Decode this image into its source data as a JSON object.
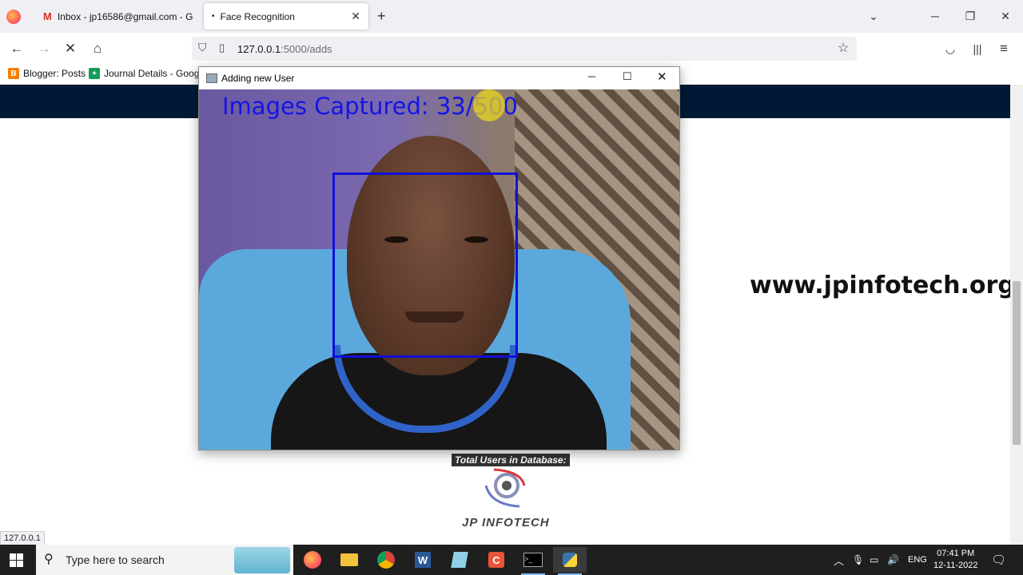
{
  "browser": {
    "tabs": [
      {
        "label": "Inbox - jp16586@gmail.com - G",
        "icon": "gmail-icon",
        "active": false
      },
      {
        "label": "Face Recognition",
        "icon": "loading-icon",
        "active": true
      }
    ],
    "url": {
      "host": "127.0.0.1",
      "path": ":5000/adds"
    },
    "bookmarks": [
      {
        "label": "Blogger: Posts",
        "icon": "blogger-icon",
        "color": "#f57d00"
      },
      {
        "label": "Journal Details - Googl...",
        "icon": "sheets-icon",
        "color": "#0f9d58"
      }
    ],
    "status_url": "127.0.0.1"
  },
  "page": {
    "header_color": "#001a36",
    "watermark": "www.jpinfotech.org",
    "total_users_label": "Total Users in Database:",
    "logo_text": "JP INFOTECH"
  },
  "capture_window": {
    "title": "Adding new User",
    "overlay_text": "Images Captured: 33/500",
    "overlay_color": "#1414e6",
    "face_box_color": "#1010d8"
  },
  "taskbar": {
    "search_placeholder": "Type here to search",
    "apps": [
      "firefox-icon",
      "file-explorer-icon",
      "chrome-icon",
      "word-icon",
      "notepad-icon",
      "tool-icon",
      "terminal-icon",
      "python-icon"
    ],
    "language": "ENG",
    "time": "07:41 PM",
    "date": "12-11-2022"
  }
}
